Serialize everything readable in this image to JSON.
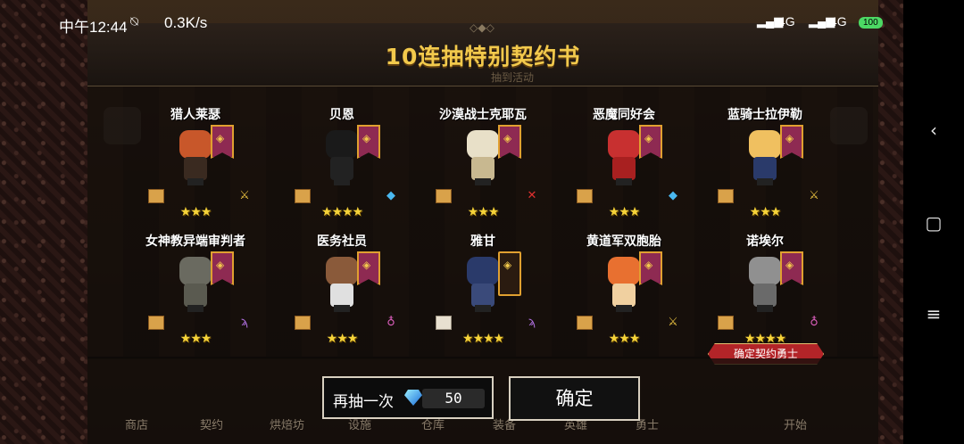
{
  "status_bar": {
    "time": "中午12:44",
    "net_speed": "0.3K/s",
    "signal_1": "4G",
    "signal_2": "4G",
    "battery": "100"
  },
  "header": {
    "title": "10连抽特别契约书",
    "subtitle": "抽到活动"
  },
  "results": [
    {
      "name": "猎人莱瑟",
      "stars": "★★★",
      "scroll": "gold",
      "class_icon": "sword-icon",
      "colors": {
        "head": "#c8572a",
        "body": "#3a2a20"
      }
    },
    {
      "name": "贝恩",
      "stars": "★★★★",
      "scroll": "gold",
      "class_icon": "gem-blue-icon",
      "colors": {
        "head": "#1a1a1a",
        "body": "#222222"
      }
    },
    {
      "name": "沙漠战士克耶瓦",
      "stars": "★★★",
      "scroll": "gold",
      "class_icon": "crossed-swords-icon",
      "colors": {
        "head": "#e8e0c8",
        "body": "#c8b890"
      }
    },
    {
      "name": "恶魔同好会",
      "stars": "★★★",
      "scroll": "gold",
      "class_icon": "gem-blue-icon",
      "colors": {
        "head": "#c83030",
        "body": "#a82020"
      }
    },
    {
      "name": "蓝骑士拉伊勒",
      "stars": "★★★",
      "scroll": "gold",
      "class_icon": "sword-icon",
      "colors": {
        "head": "#f0c060",
        "body": "#2a3a6a"
      }
    },
    {
      "name": "女神教异端审判者",
      "stars": "★★★",
      "scroll": "gold",
      "class_icon": "staff-icon",
      "colors": {
        "head": "#6a6a60",
        "body": "#5a5a50"
      }
    },
    {
      "name": "医务社员",
      "stars": "★★★",
      "scroll": "gold",
      "class_icon": "potion-icon",
      "colors": {
        "head": "#8a5a3a",
        "body": "#e0e0e0"
      }
    },
    {
      "name": "雅甘",
      "stars": "★★★★",
      "scroll": "white",
      "class_icon": "staff-icon",
      "colors": {
        "head": "#2a3a6a",
        "body": "#3a4a7a"
      }
    },
    {
      "name": "黄道军双胞胎",
      "stars": "★★★",
      "scroll": "gold",
      "class_icon": "sword-icon",
      "colors": {
        "head": "#e87030",
        "body": "#f0d0a0"
      }
    },
    {
      "name": "诺埃尔",
      "stars": "★★★★",
      "scroll": "gold",
      "class_icon": "potion-icon",
      "colors": {
        "head": "#909090",
        "body": "#6a6a6a"
      }
    }
  ],
  "confirm_ribbon": "确定契约勇士",
  "actions": {
    "redraw_label": "再抽一次",
    "redraw_cost": "50",
    "confirm_label": "确定"
  },
  "background_menu": [
    "商店",
    "契约",
    "烘焙坊",
    "设施",
    "仓库",
    "装备",
    "英雄",
    "勇士",
    "开始"
  ]
}
